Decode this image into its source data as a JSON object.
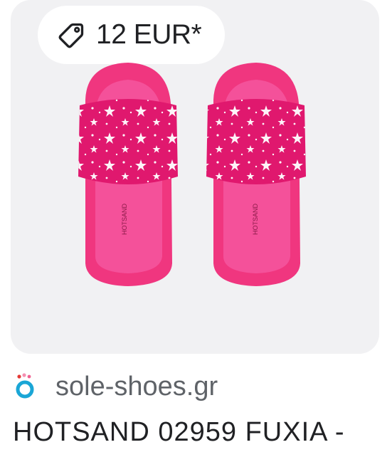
{
  "price": {
    "icon": "price-tag-icon",
    "label": "12 EUR*"
  },
  "product_image": {
    "alt": "Pink slide sandals with white stars",
    "colors": {
      "sandal": "#f0367f",
      "strap": "#e0186e",
      "stars": "#ffffff"
    }
  },
  "source": {
    "icon": "site-favicon-icon",
    "domain": "sole-shoes.gr",
    "favicon_colors": {
      "ring": "#1aa6d6",
      "dots": [
        "#e53935",
        "#f48fb1",
        "#f06292"
      ]
    }
  },
  "title": "HOTSAND 02959 FUXIA -"
}
